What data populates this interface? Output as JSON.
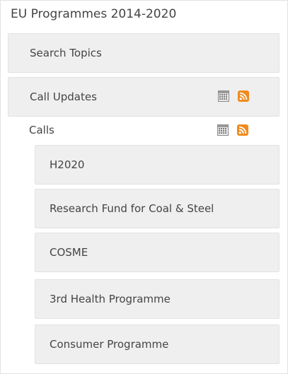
{
  "panel": {
    "title": "EU Programmes 2014-2020"
  },
  "menu": {
    "search_topics": "Search Topics",
    "call_updates": "Call Updates",
    "calls": "Calls",
    "sub_items": [
      {
        "label": "H2020"
      },
      {
        "label": "Research Fund for Coal & Steel"
      },
      {
        "label": "COSME"
      },
      {
        "label": "3rd Health Programme"
      },
      {
        "label": "Consumer Programme"
      }
    ]
  },
  "icons": {
    "calendar": "calendar-icon",
    "rss": "rss-icon"
  },
  "colors": {
    "button_bg": "#efefef",
    "rss_orange": "#f08a1c",
    "text": "#444444",
    "border": "#e2e2e2"
  }
}
